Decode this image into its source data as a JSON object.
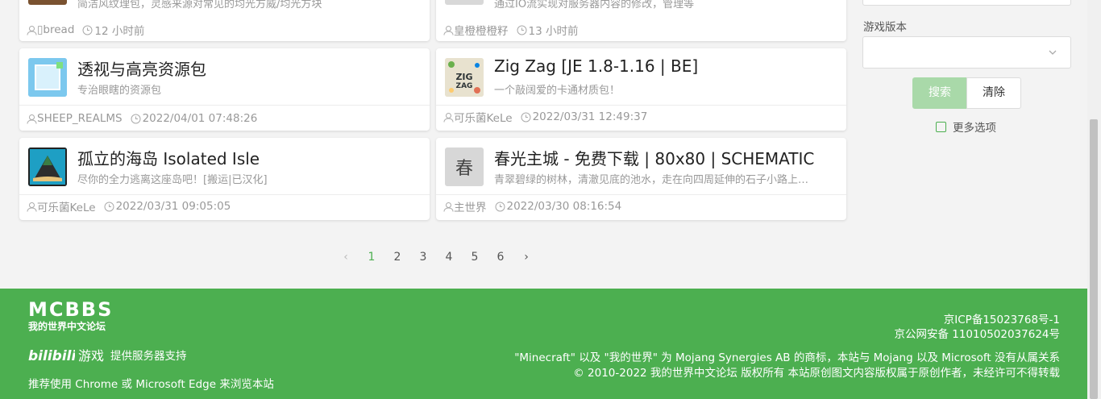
{
  "cards": [
    {
      "title": "",
      "desc": "简洁风纹理包，灵感来源对常见的均光方威/均光方块",
      "author": "▯bread",
      "time": "12 小时前"
    },
    {
      "title": "",
      "desc": "通过IO流实现对服务器内容的修改，管理等",
      "author": "皇橙橙橙籽",
      "time": "13 小时前"
    },
    {
      "title": "透视与高亮资源包",
      "desc": "专治眼瞎的资源包",
      "author": "SHEEP_REALMS",
      "time": "2022/04/01 07:48:26"
    },
    {
      "title": "Zig Zag [JE 1.8-1.16 | BE]",
      "desc": "一个敲阔爱的卡通材质包！",
      "author": "可乐菌KeLe",
      "time": "2022/03/31 12:49:37"
    },
    {
      "title": "孤立的海岛 Isolated Isle",
      "desc": "尽你的全力逃离这座岛吧！[搬运|已汉化]",
      "author": "可乐菌KeLe",
      "time": "2022/03/31 09:05:05"
    },
    {
      "title": "春光主城 - 免费下载 | 80x80 | SCHEMATIC",
      "desc": "青翠碧绿的树林，清澈见底的池水，走在向四周延伸的石子小路上…",
      "author": "主世界",
      "time": "2022/03/30 08:16:54",
      "avatar_char": "春"
    }
  ],
  "pagination": {
    "pages": [
      "1",
      "2",
      "3",
      "4",
      "5",
      "6"
    ],
    "current": "1",
    "prev": "‹",
    "next": "›"
  },
  "sidebar": {
    "version_label": "游戏版本",
    "version_value": "",
    "search_label": "搜索",
    "clear_label": "清除",
    "more_options_label": "更多选项"
  },
  "footer": {
    "logo_text": "MCBBS",
    "slogan": "我的世界中文论坛",
    "bili_logo": "bilibili",
    "bili_game": "游戏",
    "bili_support": "提供服务器支持",
    "browser_note": "推荐使用 Chrome 或 Microsoft Edge 来浏览本站",
    "icp": "京ICP备15023768号-1",
    "police": "京公网安备 11010502037624号",
    "trademark": "\"Minecraft\" 以及 \"我的世界\" 为 Mojang Synergies AB 的商标，本站与 Mojang 以及 Microsoft 没有从属关系",
    "copyright": "© 2010-2022 我的世界中文论坛 版权所有 本站原创图文内容版权属于原创作者，未经许可不得转载"
  },
  "colors": {
    "brand_green": "#4caf50",
    "search_disabled": "#a9d9a9"
  }
}
